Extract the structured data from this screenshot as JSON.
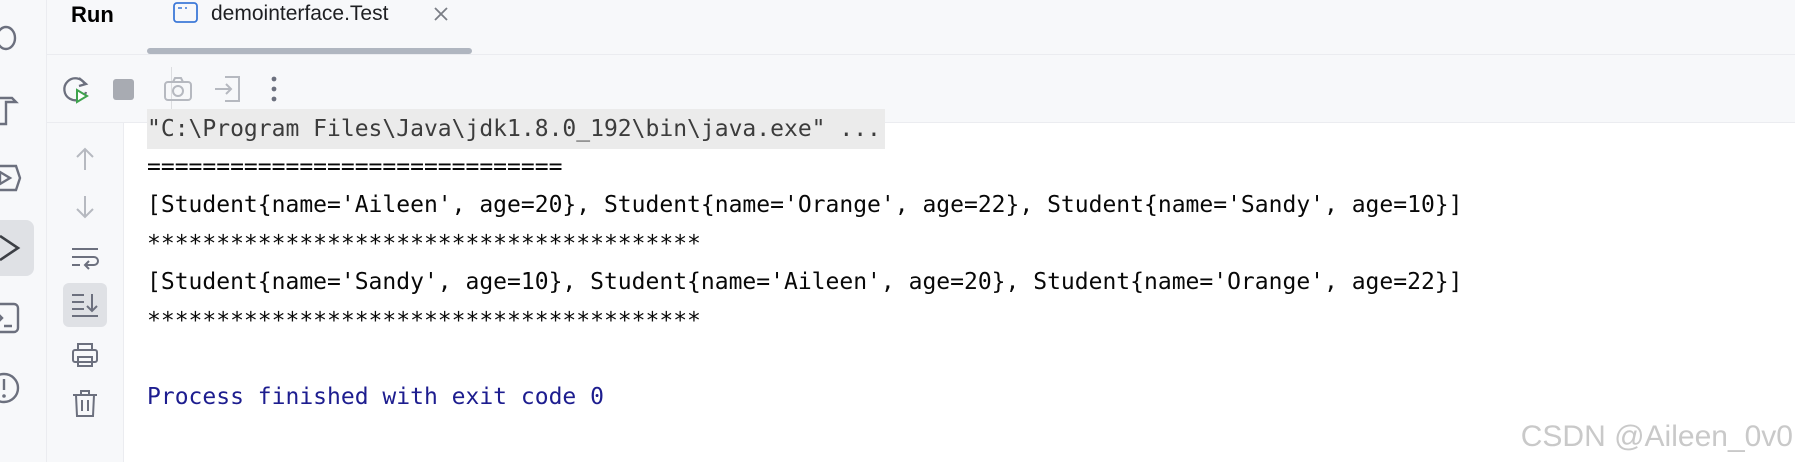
{
  "header": {
    "panel_title": "Run",
    "tab": {
      "title": "demointerface.Test"
    }
  },
  "console": {
    "lines": [
      "\"C:\\Program Files\\Java\\jdk1.8.0_192\\bin\\java.exe\" ...",
      "==============================",
      "[Student{name='Aileen', age=20}, Student{name='Orange', age=22}, Student{name='Sandy', age=10}]",
      "****************************************",
      "[Student{name='Sandy', age=10}, Student{name='Aileen', age=20}, Student{name='Orange', age=22}]",
      "****************************************",
      "",
      "Process finished with exit code 0"
    ]
  },
  "watermark": "CSDN @Aileen_0v0",
  "icons": {
    "leftbar": [
      "debug-icon",
      "build-icon",
      "services-icon",
      "run-icon",
      "terminal-icon",
      "problems-icon"
    ],
    "toolbar": [
      "rerun-icon",
      "stop-icon",
      "screenshot-icon",
      "exit-icon",
      "more-icon"
    ],
    "gutter": [
      "up-arrow-icon",
      "down-arrow-icon",
      "soft-wrap-icon",
      "scroll-to-end-icon",
      "print-icon",
      "trash-icon"
    ]
  },
  "colors": {
    "accent_green": "#3fa34d",
    "exit_text": "#1d1d8f",
    "panel_bg": "#f7f8fa"
  }
}
